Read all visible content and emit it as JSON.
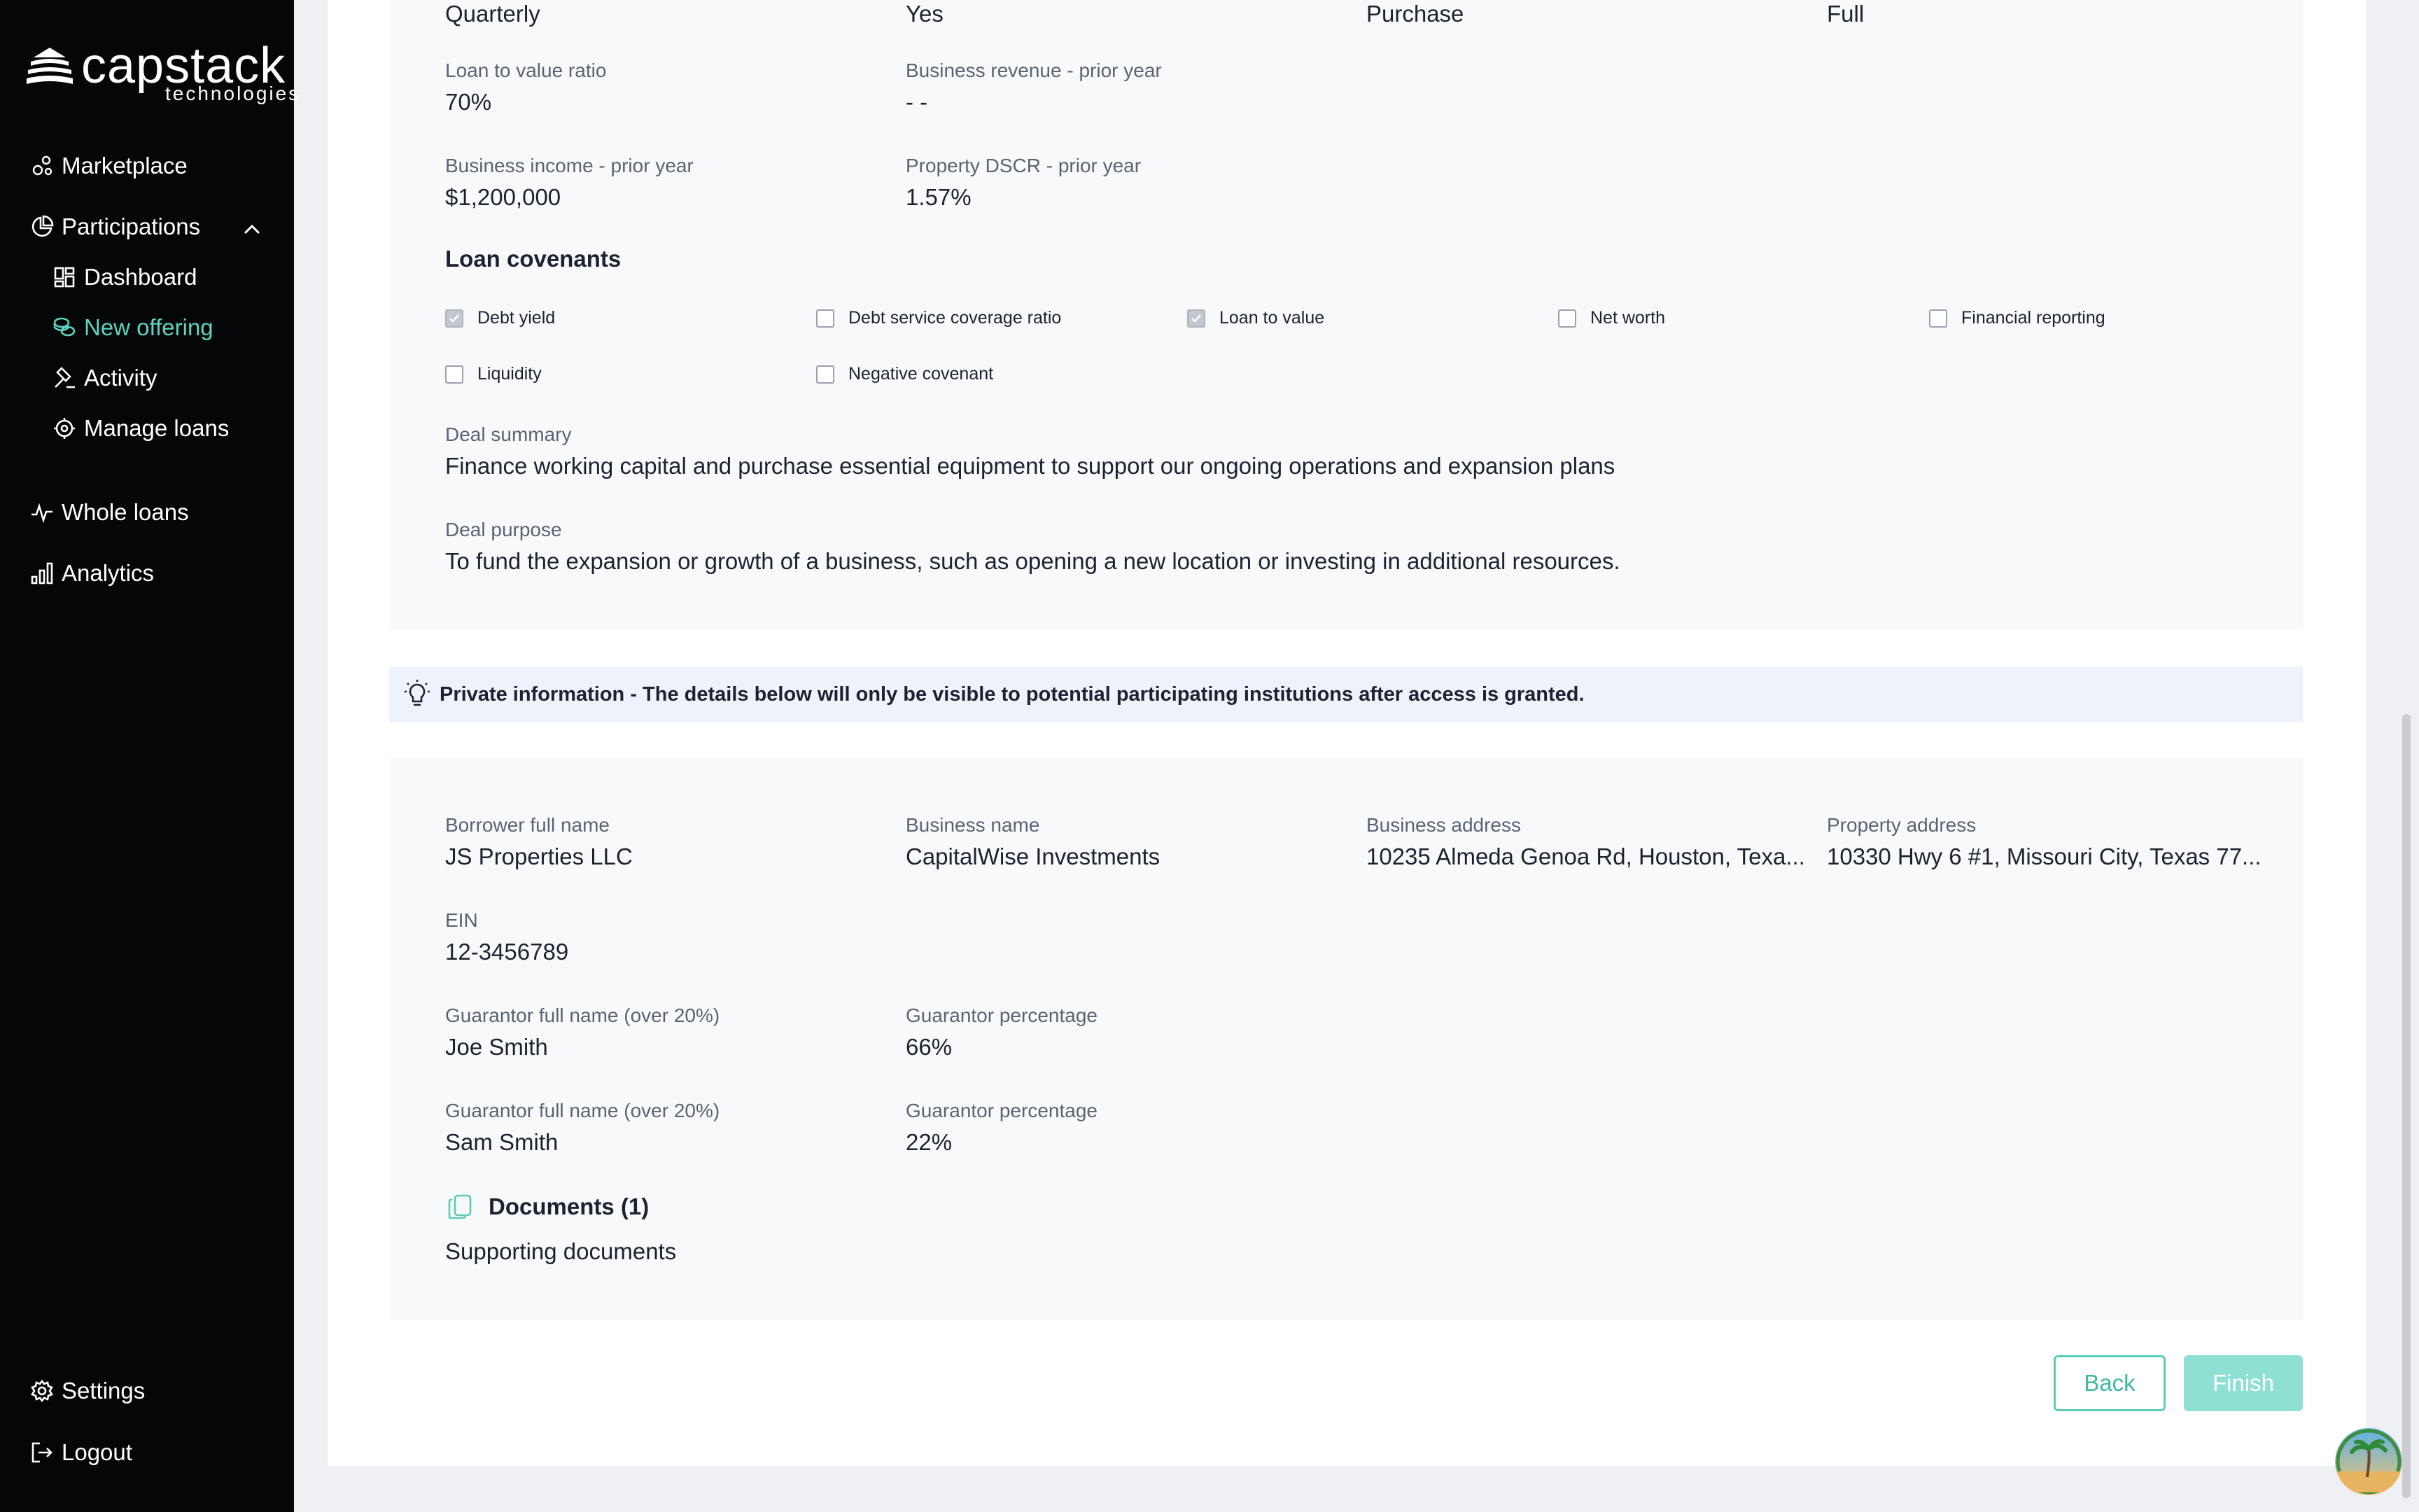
{
  "brand": {
    "name": "capstack",
    "tagline": "technologies"
  },
  "nav": {
    "marketplace": "Marketplace",
    "participations": "Participations",
    "dashboard": "Dashboard",
    "new_offering": "New offering",
    "activity": "Activity",
    "manage_loans": "Manage loans",
    "whole_loans": "Whole loans",
    "analytics": "Analytics",
    "settings": "Settings",
    "logout": "Logout"
  },
  "top_row": [
    "Quarterly",
    "Yes",
    "Purchase",
    "Full"
  ],
  "loan_fields": {
    "ltv": {
      "label": "Loan to value ratio",
      "value": "70%"
    },
    "revenue": {
      "label": "Business revenue - prior year",
      "value": "- -"
    },
    "income": {
      "label": "Business income - prior year",
      "value": "$1,200,000"
    },
    "dscr": {
      "label": "Property DSCR - prior year",
      "value": "1.57%"
    }
  },
  "covenants": {
    "title": "Loan covenants",
    "items": [
      {
        "label": "Debt yield",
        "checked": true
      },
      {
        "label": "Debt service coverage ratio",
        "checked": false
      },
      {
        "label": "Loan to value",
        "checked": true
      },
      {
        "label": "Net worth",
        "checked": false
      },
      {
        "label": "Financial reporting",
        "checked": false
      },
      {
        "label": "Liquidity",
        "checked": false
      },
      {
        "label": "Negative covenant",
        "checked": false
      }
    ]
  },
  "deal_summary": {
    "label": "Deal summary",
    "value": "Finance working capital and purchase essential equipment to support our ongoing operations and expansion plans"
  },
  "deal_purpose": {
    "label": "Deal purpose",
    "value": "To fund the expansion or growth of a business, such as opening a new location or investing in additional resources."
  },
  "private_notice": "Private information - The details below will only be visible to potential participating institutions after access is granted.",
  "private": {
    "borrower": {
      "label": "Borrower full name",
      "value": "JS Properties LLC"
    },
    "business_name": {
      "label": "Business name",
      "value": "CapitalWise Investments"
    },
    "business_address": {
      "label": "Business address",
      "value": "10235 Almeda Genoa Rd, Houston, Texa..."
    },
    "property_address": {
      "label": "Property address",
      "value": "10330 Hwy 6 #1, Missouri City, Texas 77..."
    },
    "ein": {
      "label": "EIN",
      "value": "12-3456789"
    },
    "guarantor1": {
      "label": "Guarantor full name (over 20%)",
      "value": "Joe Smith"
    },
    "guarantor1_pct": {
      "label": "Guarantor percentage",
      "value": "66%"
    },
    "guarantor2": {
      "label": "Guarantor full name (over 20%)",
      "value": "Sam Smith"
    },
    "guarantor2_pct": {
      "label": "Guarantor percentage",
      "value": "22%"
    }
  },
  "documents": {
    "title": "Documents (1)",
    "item": "Supporting documents"
  },
  "buttons": {
    "back": "Back",
    "finish": "Finish"
  },
  "colors": {
    "accent": "#5dd4be",
    "sidebar_bg": "#050607"
  }
}
